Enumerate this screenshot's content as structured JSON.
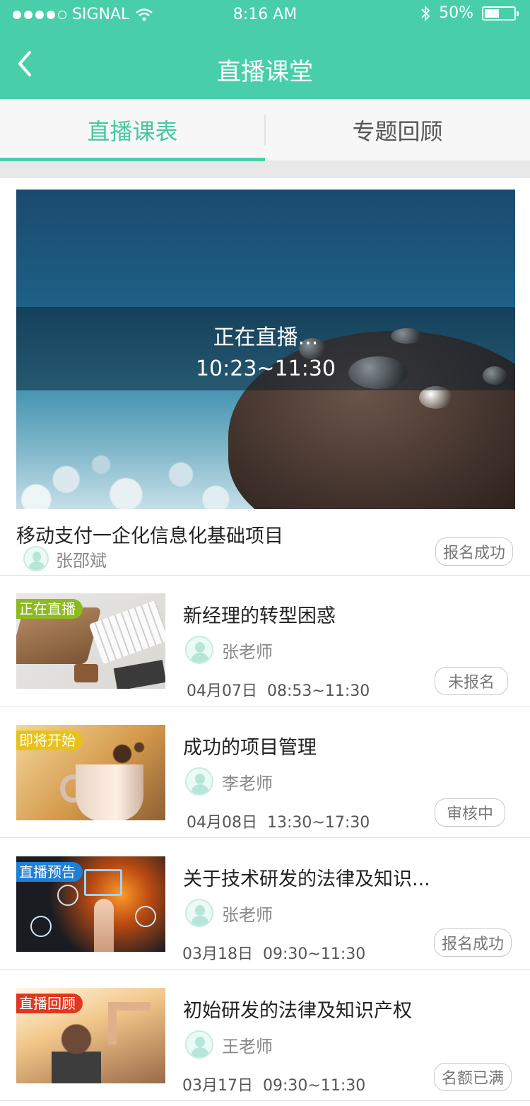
{
  "status_bar": {
    "carrier": "SIGNAL",
    "time": "8:16 AM",
    "battery": "50%",
    "battery_level": 0.5
  },
  "nav": {
    "title": "直播课堂"
  },
  "tabs": [
    {
      "label": "直播课表",
      "active": true
    },
    {
      "label": "专题回顾",
      "active": false
    }
  ],
  "featured": {
    "live_text": "正在直播...",
    "time_range": "10:23~11:30",
    "title": "移动支付一企化信息化基础项目",
    "teacher": "张邵斌",
    "status": "报名成功"
  },
  "items": [
    {
      "tag": "正在直播",
      "tag_color": "#8dbb1f",
      "title": "新经理的转型困惑",
      "teacher": "张老师",
      "date": "04月07日",
      "time": "08:53~11:30",
      "status": "未报名"
    },
    {
      "tag": "即将开始",
      "tag_color": "#e8c21a",
      "title": "成功的项目管理",
      "teacher": "李老师",
      "date": "04月08日",
      "time": "13:30~17:30",
      "status": "审核中"
    },
    {
      "tag": "直播预告",
      "tag_color": "#1f7fd6",
      "title": "关于技术研发的法律及知识...",
      "teacher": "张老师",
      "date": "03月18日",
      "time": "09:30~11:30",
      "status": "报名成功"
    },
    {
      "tag": "直播回顾",
      "tag_color": "#e0371f",
      "title": "初始研发的法律及知识产权",
      "teacher": "王老师",
      "date": "03月17日",
      "time": "09:30~11:30",
      "status": "名额已满"
    }
  ],
  "colors": {
    "brand": "#48cfaa",
    "tab_active": "#48c7a0"
  }
}
